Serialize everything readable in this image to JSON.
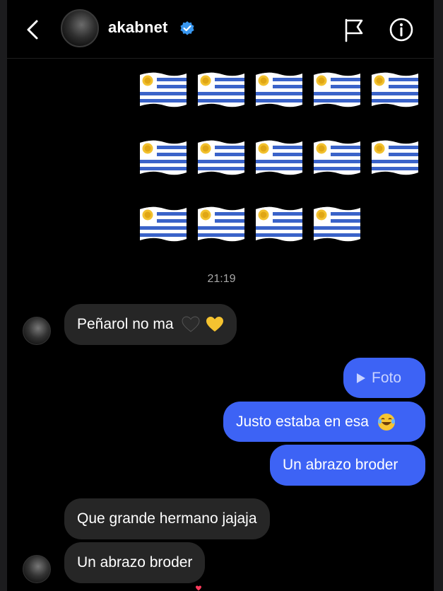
{
  "header": {
    "username": "akabnet",
    "back_icon": "chevron-left-icon",
    "verified_icon": "verified-badge-icon",
    "flag_icon": "flag-icon",
    "info_icon": "info-icon"
  },
  "flags": {
    "emoji": "uruguay-flag",
    "rows": [
      5,
      5,
      4
    ]
  },
  "messages": {
    "timestamp": "21:19",
    "m1": "Peñarol no ma",
    "m2": "Foto",
    "m3": "Justo estaba en esa",
    "m4": "Un abrazo broder",
    "m5": "Que grande hermano jajaja",
    "m6": "Un abrazo broder"
  },
  "colors": {
    "outgoing": "#3d63f5",
    "incoming": "#262626",
    "background": "#000000",
    "verified": "#3897f0"
  }
}
